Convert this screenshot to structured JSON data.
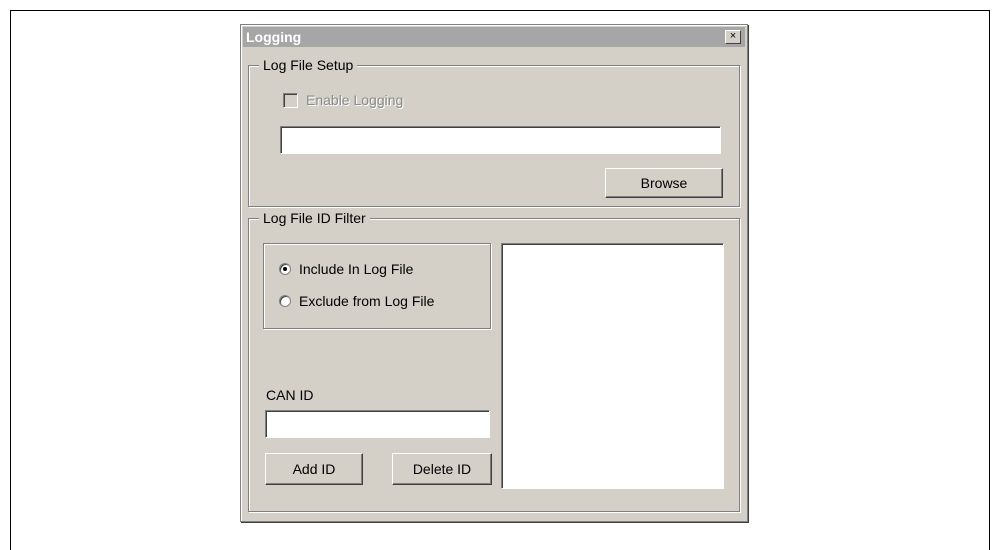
{
  "dialog": {
    "title": "Logging",
    "close_symbol": "×"
  },
  "log_setup": {
    "group_label": "Log File Setup",
    "enable_label": "Enable Logging",
    "enable_checked": false,
    "enable_disabled": true,
    "path_value": "",
    "browse_label": "Browse"
  },
  "id_filter": {
    "group_label": "Log File ID Filter",
    "include_label": "Include In Log File",
    "exclude_label": "Exclude from Log File",
    "selected": "include",
    "can_id_label": "CAN ID",
    "can_id_value": "",
    "add_label": "Add ID",
    "delete_label": "Delete ID",
    "id_list": []
  }
}
